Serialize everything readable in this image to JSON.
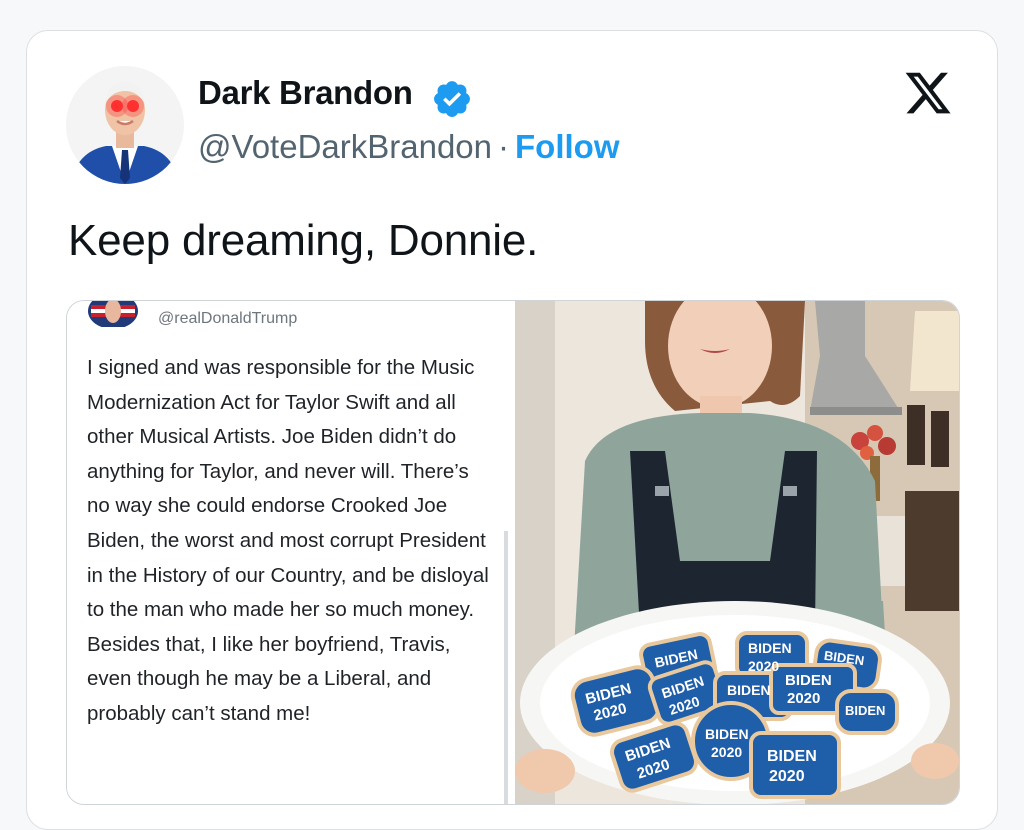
{
  "post": {
    "author_name": "Dark Brandon",
    "handle": "@VoteDarkBrandon",
    "separator": "·",
    "follow_label": "Follow",
    "text": "Keep dreaming, Donnie."
  },
  "embedded": {
    "quote_handle": "@realDonaldTrump",
    "quote_text": "I signed and was responsible for the Music Modernization Act for Taylor Swift and all other Musical Artists. Joe Biden didn’t do anything for Taylor, and never will. There’s no way she could endorse Crooked Joe Biden, the worst and most corrupt President in the History of our Country, and be disloyal to the man who made her so much money. Besides that, I like her boyfriend, Travis, even though he may be a Liberal, and probably can’t stand me!",
    "cookie_texts": [
      "BIDEN",
      "2020"
    ]
  },
  "colors": {
    "link_blue": "#1d9bf0",
    "text_dark": "#0f1419",
    "text_muted": "#536471",
    "cookie_blue": "#1f5ea8"
  },
  "icons": [
    "verified-badge-icon",
    "x-logo-icon"
  ]
}
